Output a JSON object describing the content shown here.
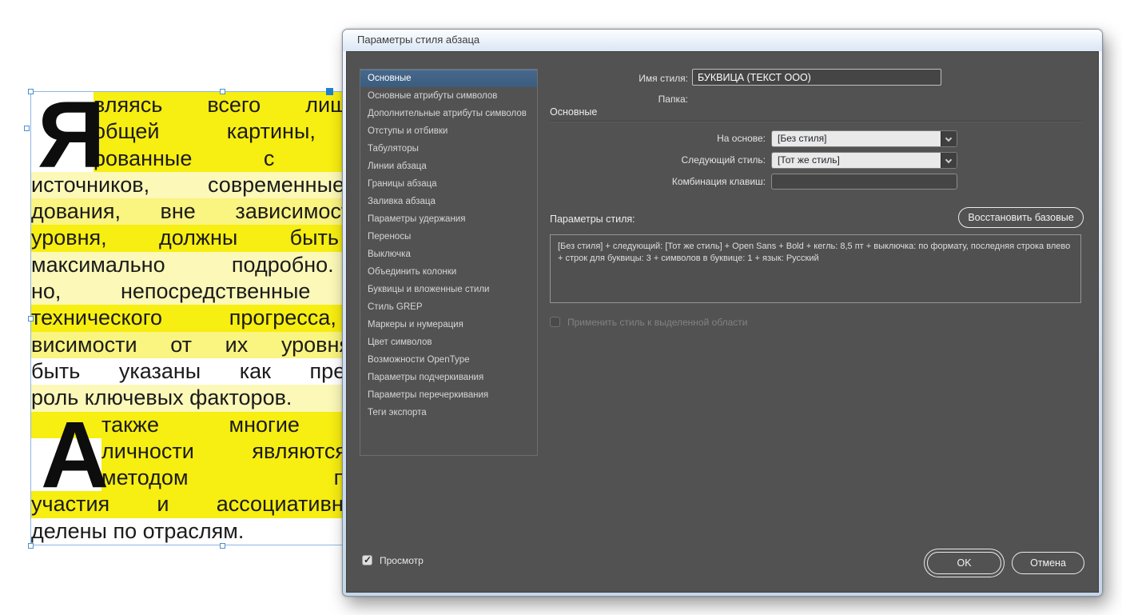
{
  "dialog": {
    "title": "Параметры стиля абзаца",
    "sidebar": {
      "selected_index": 0,
      "items": [
        "Основные",
        "Основные атрибуты символов",
        "Дополнительные атрибуты символов",
        "Отступы и отбивки",
        "Табуляторы",
        "Линии абзаца",
        "Границы абзаца",
        "Заливка абзаца",
        "Параметры удержания",
        "Переносы",
        "Выключка",
        "Объединить колонки",
        "Буквицы и вложенные стили",
        "Стиль GREP",
        "Маркеры и нумерация",
        "Цвет символов",
        "Возможности OpenType",
        "Параметры подчеркивания",
        "Параметры перечеркивания",
        "Теги экспорта"
      ]
    },
    "fields": {
      "style_name_label": "Имя стиля:",
      "style_name_value": "БУКВИЦА (ТЕКСТ ООО)",
      "folder_label": "Папка:",
      "section_header": "Основные",
      "based_on_label": "На основе:",
      "based_on_value": "[Без стиля]",
      "next_style_label": "Следующий стиль:",
      "next_style_value": "[Тот же стиль]",
      "shortcut_label": "Комбинация клавиш:",
      "shortcut_value": "",
      "style_settings_label": "Параметры стиля:",
      "reset_button_label": "Восстановить базовые",
      "style_settings_text": "[Без стиля] + следующий: [Тот же стиль] + Open Sans + Bold + кегль: 8,5 пт + выключка: по формату, последняя строка влево + строк для буквицы:  3 + символов в буквице:  1 + язык: Русский",
      "apply_checkbox_label": "Применить стиль к выделенной области",
      "apply_checkbox_checked": false,
      "preview_checkbox_label": "Просмотр",
      "preview_checkbox_checked": true,
      "ok_label": "OK",
      "cancel_label": "Отмена"
    }
  },
  "document": {
    "paragraphs": [
      {
        "dropcap": "Я",
        "lines": [
          {
            "text": "вляясь всего лишь ч",
            "hl": "bright",
            "indent": true,
            "justify": true
          },
          {
            "text": "общей картины, рег",
            "hl": "bright",
            "indent": true,
            "justify": true
          },
          {
            "text": "рованные с зарубе",
            "hl": "bright",
            "indent": true,
            "justify": true
          },
          {
            "text": "источников, современные и",
            "hl": "pale",
            "indent": false,
            "justify": true
          },
          {
            "text": "дования, вне зависимости о",
            "hl": "mid",
            "indent": false,
            "justify": true
          },
          {
            "text": "уровня, должны быть оп",
            "hl": "bright",
            "indent": false,
            "justify": true
          },
          {
            "text": "максимально подробно. В",
            "hl": "pale",
            "indent": false,
            "justify": true
          },
          {
            "text": "но, непосредственные учас",
            "hl": "pale",
            "indent": false,
            "justify": true
          },
          {
            "text": "технического прогресса, в",
            "hl": "bright",
            "indent": false,
            "justify": true
          },
          {
            "text": "висимости от их уровня, до",
            "hl": "mid",
            "indent": false,
            "justify": true
          },
          {
            "text": "быть указаны как претенден",
            "hl": "none",
            "indent": false,
            "justify": true
          },
          {
            "text": "роль ключевых факторов.",
            "hl": "pale",
            "indent": false,
            "justify": false
          }
        ]
      },
      {
        "dropcap": "А",
        "lines": [
          {
            "text": "также многие изве",
            "hl": "bright",
            "indent": true,
            "justify": true,
            "full_hl": true
          },
          {
            "text": "личности являются т",
            "hl": "bright",
            "indent": true,
            "justify": true
          },
          {
            "text": "методом политич",
            "hl": "bright",
            "indent": true,
            "justify": true
          },
          {
            "text": "участия и ассоциативно р",
            "hl": "bright",
            "indent": false,
            "justify": true
          },
          {
            "text": "делены по отраслям.",
            "hl": "none",
            "indent": false,
            "justify": false
          }
        ]
      }
    ]
  },
  "colors": {
    "hl_bright": "#f7ee12",
    "hl_mid": "#faf480",
    "hl_pale": "#fbf8b8",
    "selection_blue": "#3d6080",
    "frame_blue": "#8fb6e4",
    "dialog_bg": "#525252"
  }
}
